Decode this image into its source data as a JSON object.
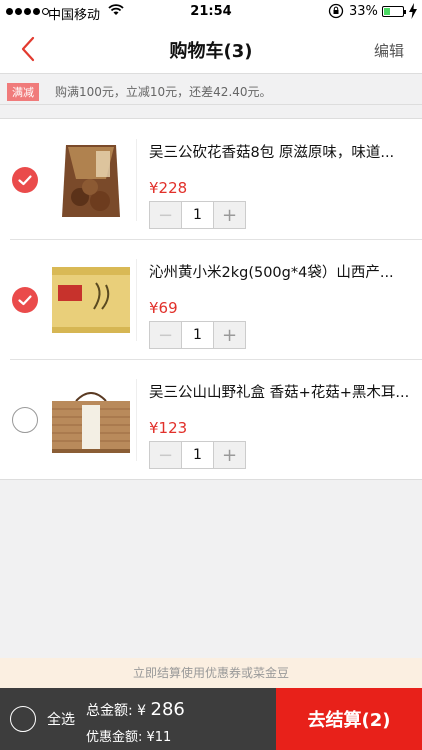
{
  "status_bar": {
    "carrier": "中国移动",
    "time": "21:54",
    "battery_percent": "33%",
    "battery_level": 0.33,
    "icons": [
      "signal-icon",
      "wifi-icon",
      "rotation-lock-icon",
      "battery-icon",
      "charging-icon"
    ]
  },
  "nav": {
    "title": "购物车(3)",
    "edit_label": "编辑",
    "back_icon": "chevron-left-icon"
  },
  "promo": {
    "tag": "满减",
    "text": "购满100元，立减10元，还差42.40元。"
  },
  "items": [
    {
      "title": "吴三公砍花香菇8包 原滋原味，味道...",
      "price": "¥228",
      "quantity": "1",
      "checked": true
    },
    {
      "title": "沁州黄小米2kg(500g*4袋）山西产...",
      "price": "¥69",
      "quantity": "1",
      "checked": true
    },
    {
      "title": "吴三公山山野礼盒 香菇+花菇+黑木耳...",
      "price": "¥123",
      "quantity": "1",
      "checked": false
    }
  ],
  "stepper": {
    "minus": "−",
    "plus": "+"
  },
  "coupon_hint": "立即结算使用优惠券或菜金豆",
  "footer": {
    "select_all": "全选",
    "total_label": "总金额: ¥",
    "total_amount": "286",
    "discount_label": "优惠金额: ¥11",
    "checkout_label": "去结算(2)"
  },
  "colors": {
    "accent": "#e8211a",
    "check": "#ea4b4b",
    "price": "#e1302a",
    "footer_bg": "#3d3d3d"
  }
}
